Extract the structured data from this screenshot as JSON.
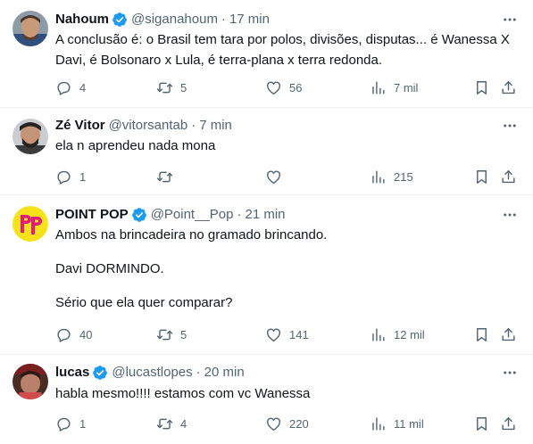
{
  "tweets": [
    {
      "name": "Nahoum",
      "verified": true,
      "handle": "@siganahoum",
      "sep": "·",
      "time": "17 min",
      "lines": [
        "A conclusão é: o Brasil tem tara por polos, divisões, disputas... é Wanessa X",
        "Davi, é Bolsonaro x Lula, é terra-plana x terra redonda."
      ],
      "replies": "4",
      "retweets": "5",
      "likes": "56",
      "views": "7 mil"
    },
    {
      "name": "Zé Vitor",
      "verified": false,
      "handle": "@vitorsantab",
      "sep": "·",
      "time": "7 min",
      "lines": [
        "ela n aprendeu nada mona"
      ],
      "replies": "1",
      "retweets": "",
      "likes": "",
      "views": "215"
    },
    {
      "name": "POINT POP",
      "verified": true,
      "handle": "@Point__Pop",
      "sep": "·",
      "time": "21 min",
      "lines": [
        "Ambos na brincadeira no gramado brincando.",
        "",
        "Davi DORMINDO.",
        "",
        "Sério que ela quer comparar?"
      ],
      "replies": "40",
      "retweets": "5",
      "likes": "141",
      "views": "12 mil"
    },
    {
      "name": "lucas",
      "verified": true,
      "handle": "@lucastlopes",
      "sep": "·",
      "time": "20 min",
      "lines": [
        "habla mesmo!!!! estamos com vc Wanessa"
      ],
      "replies": "1",
      "retweets": "4",
      "likes": "220",
      "views": "11 mil"
    }
  ],
  "icons": {
    "verified": "verified-badge-icon",
    "more": "more-options-icon",
    "reply": "reply-icon",
    "retweet": "retweet-icon",
    "like": "heart-icon",
    "views": "views-chart-icon",
    "bookmark": "bookmark-icon",
    "share": "share-icon"
  },
  "colors": {
    "verified": "#1d9bf0",
    "secondary_text": "#536471",
    "primary_text": "#0f1419",
    "point_pop_brand": "#f7e21a",
    "point_pop_letters": "#e6197d"
  }
}
